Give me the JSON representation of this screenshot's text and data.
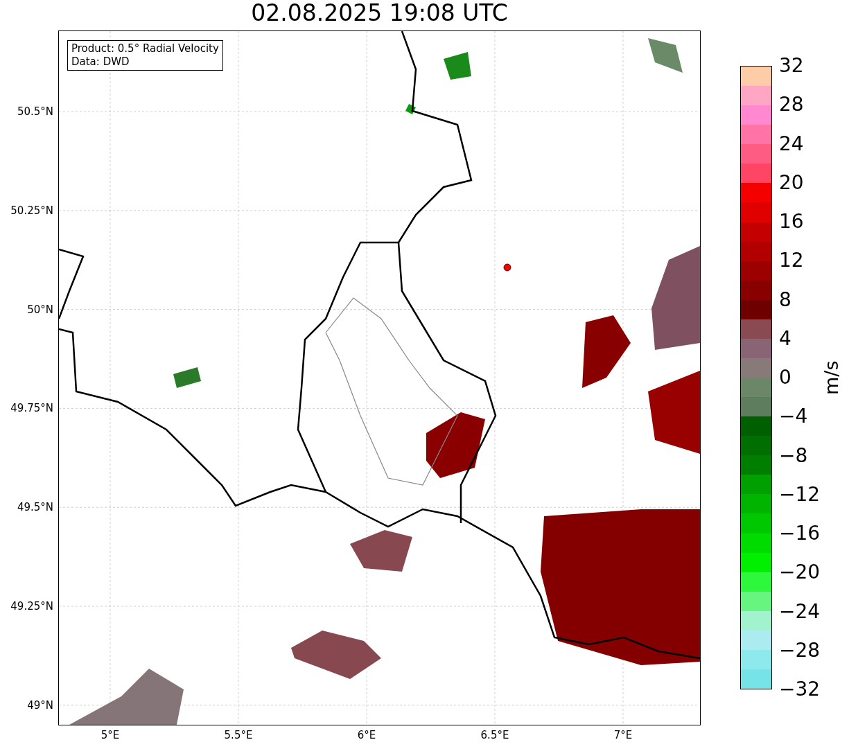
{
  "title": "02.08.2025 19:08 UTC",
  "info_box": [
    "Product: 0.5° Radial Velocity",
    "Data: DWD"
  ],
  "x_ticks": [
    "5°E",
    "5.5°E",
    "6°E",
    "6.5°E",
    "7°E"
  ],
  "y_ticks": [
    "50.5°N",
    "50.25°N",
    "50°N",
    "49.75°N",
    "49.5°N",
    "49.25°N",
    "49°N"
  ],
  "colorbar": {
    "label": "m/s",
    "ticks": [
      "32",
      "28",
      "24",
      "20",
      "16",
      "12",
      "8",
      "4",
      "0",
      "−4",
      "−8",
      "−12",
      "−16",
      "−20",
      "−24",
      "−28",
      "−32"
    ],
    "bands": [
      {
        "color": "#ffcca8"
      },
      {
        "color": "#ffa6c4"
      },
      {
        "color": "#ff88d0"
      },
      {
        "color": "#ff74a4"
      },
      {
        "color": "#ff5c84"
      },
      {
        "color": "#ff4464"
      },
      {
        "color": "#f50000"
      },
      {
        "color": "#e00000"
      },
      {
        "color": "#c40000"
      },
      {
        "color": "#b20000"
      },
      {
        "color": "#9c0000"
      },
      {
        "color": "#880000"
      },
      {
        "color": "#6e0000"
      },
      {
        "color": "#8a4a52"
      },
      {
        "color": "#896474"
      },
      {
        "color": "#877a78"
      },
      {
        "color": "#6b8768"
      },
      {
        "color": "#5e7d5c"
      },
      {
        "color": "#005f00"
      },
      {
        "color": "#006e00"
      },
      {
        "color": "#007e00"
      },
      {
        "color": "#00a000"
      },
      {
        "color": "#00b400"
      },
      {
        "color": "#00c800"
      },
      {
        "color": "#00dc00"
      },
      {
        "color": "#00f000"
      },
      {
        "color": "#2ef83c"
      },
      {
        "color": "#66f57e"
      },
      {
        "color": "#a0f3cc"
      },
      {
        "color": "#acebef"
      },
      {
        "color": "#8ee9ec"
      },
      {
        "color": "#76e3e8"
      }
    ]
  }
}
